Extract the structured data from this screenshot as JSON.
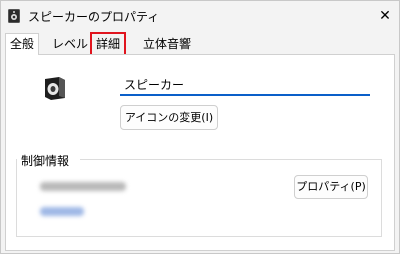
{
  "window": {
    "title": "スピーカーのプロパティ",
    "close_glyph": "✕",
    "icon": "speaker-properties-icon"
  },
  "tabs": [
    {
      "label": "全般",
      "active": true
    },
    {
      "label": "レベル",
      "active": false
    },
    {
      "label": "詳細",
      "active": false,
      "highlighted": true
    },
    {
      "label": "立体音響",
      "active": false
    }
  ],
  "general": {
    "device_icon": "speaker-icon",
    "name_value": "スピーカー",
    "change_icon_label": "アイコンの変更(I)",
    "controller_group_label": "制御情報",
    "properties_button_label": "プロパティ(P)"
  },
  "colors": {
    "highlight": "#e0141e",
    "accent": "#0a5fc9"
  }
}
